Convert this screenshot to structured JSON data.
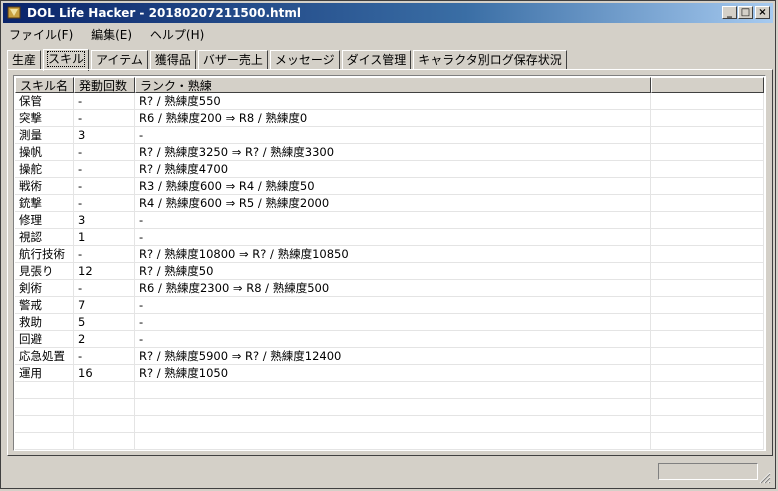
{
  "window": {
    "title": "DOL Life Hacker - 20180207211500.html"
  },
  "titlebar_buttons": {
    "minimize": "_",
    "maximize": "□",
    "close": "×"
  },
  "menu": [
    "ファイル(F)",
    "編集(E)",
    "ヘルプ(H)"
  ],
  "tabs": [
    "生産",
    "スキル",
    "アイテム",
    "獲得品",
    "バザー売上",
    "メッセージ",
    "ダイス管理",
    "キャラクタ別ログ保存状況"
  ],
  "active_tab_index": 1,
  "table": {
    "columns": [
      "スキル名",
      "発動回数",
      "ランク・熟練",
      ""
    ],
    "rows": [
      [
        "保管",
        "-",
        "R? / 熟練度550"
      ],
      [
        "突撃",
        "-",
        "R6 / 熟練度200 ⇒ R8 / 熟練度0"
      ],
      [
        "測量",
        "3",
        "-"
      ],
      [
        "操帆",
        "-",
        "R? / 熟練度3250 ⇒ R? / 熟練度3300"
      ],
      [
        "操舵",
        "-",
        "R? / 熟練度4700"
      ],
      [
        "戦術",
        "-",
        "R3 / 熟練度600 ⇒ R4 / 熟練度50"
      ],
      [
        "銃撃",
        "-",
        "R4 / 熟練度600 ⇒ R5 / 熟練度2000"
      ],
      [
        "修理",
        "3",
        "-"
      ],
      [
        "視認",
        "1",
        "-"
      ],
      [
        "航行技術",
        "-",
        "R? / 熟練度10800 ⇒ R? / 熟練度10850"
      ],
      [
        "見張り",
        "12",
        "R? / 熟練度50"
      ],
      [
        "剣術",
        "-",
        "R6 / 熟練度2300 ⇒ R8 / 熟練度500"
      ],
      [
        "警戒",
        "7",
        "-"
      ],
      [
        "救助",
        "5",
        "-"
      ],
      [
        "回避",
        "2",
        "-"
      ],
      [
        "応急処置",
        "-",
        "R? / 熟練度5900 ⇒ R? / 熟練度12400"
      ],
      [
        "運用",
        "16",
        "R? / 熟練度1050"
      ],
      [
        "",
        "",
        ""
      ],
      [
        "",
        "",
        ""
      ],
      [
        "",
        "",
        ""
      ],
      [
        "",
        "",
        ""
      ],
      [
        "",
        "",
        ""
      ]
    ]
  },
  "status": {
    "text": ""
  }
}
